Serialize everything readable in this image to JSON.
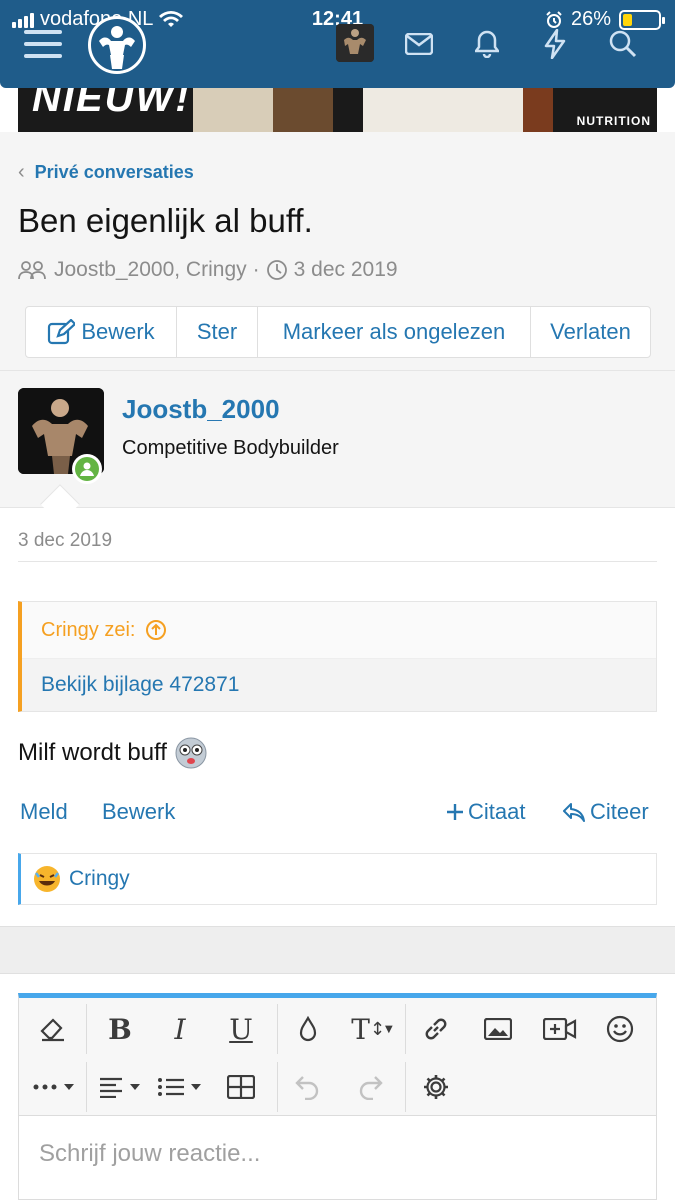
{
  "status_bar": {
    "carrier": "vodafone NL",
    "time": "12:41",
    "battery": "26%",
    "battery_level": 0.26
  },
  "nav": {
    "icons": [
      "menu-icon",
      "site-logo",
      "user-avatar",
      "mail-icon",
      "bell-icon",
      "bolt-icon",
      "search-icon"
    ]
  },
  "banner": {
    "headline": "NIEUW!",
    "brand": "NUTRITION"
  },
  "breadcrumb": {
    "label": "Privé conversaties"
  },
  "conversation": {
    "title": "Ben eigenlijk al buff.",
    "participants": "Joostb_2000, Cringy",
    "separator": "·",
    "date": "3 dec 2019"
  },
  "buttons": {
    "edit": "Bewerk",
    "star": "Ster",
    "mark_unread": "Markeer als ongelezen",
    "leave": "Verlaten"
  },
  "message": {
    "author": "Joostb_2000",
    "author_title": "Competitive Bodybuilder",
    "date": "3 dec 2019",
    "quote_author": "Cringy zei:",
    "quote_body": "Bekijk bijlage 472871",
    "text": "Milf wordt buff",
    "actions": {
      "report": "Meld",
      "edit": "Bewerk",
      "quote_multi": "Citaat",
      "reply": "Citeer"
    },
    "reaction_user": "Cringy"
  },
  "editor": {
    "placeholder": "Schrijf jouw reactie..."
  },
  "colors": {
    "header": "#1f5c8a",
    "link": "#2577b1",
    "quote_accent": "#f5a021",
    "online": "#63b443",
    "editor_accent": "#47a7eb"
  }
}
